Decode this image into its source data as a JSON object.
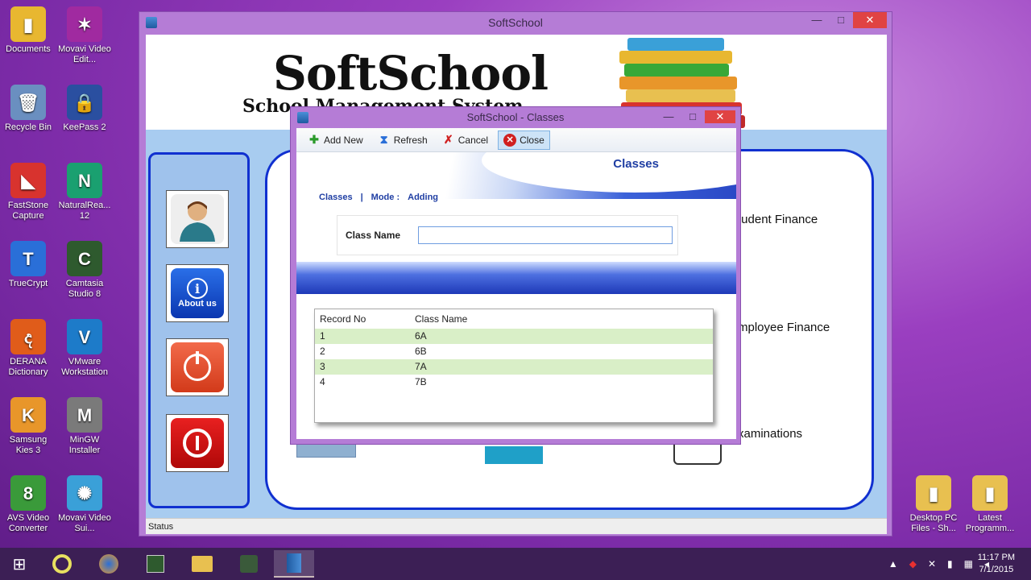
{
  "desktop": {
    "icons_left": [
      {
        "label": "Documents",
        "glyph": "▮",
        "color": "#e8b730"
      },
      {
        "label": "Recycle Bin",
        "glyph": "🗑",
        "color": "#6a8fc0"
      },
      {
        "label": "FastStone Capture",
        "glyph": "◣",
        "color": "#d8332e"
      },
      {
        "label": "TrueCrypt",
        "glyph": "T",
        "color": "#2a6fd8"
      },
      {
        "label": "DERANA Dictionary",
        "glyph": "ද",
        "color": "#e05c1a"
      },
      {
        "label": "Samsung Kies 3",
        "glyph": "K",
        "color": "#e8962a"
      },
      {
        "label": "AVS Video Converter",
        "glyph": "8",
        "color": "#3a9a3a"
      }
    ],
    "icons_mid": [
      {
        "label": "Movavi Video Edit...",
        "glyph": "✶",
        "color": "#a02aa0"
      },
      {
        "label": "KeePass 2",
        "glyph": "🔒",
        "color": "#2a4fa0"
      },
      {
        "label": "NaturalRea... 12",
        "glyph": "N",
        "color": "#1aa070"
      },
      {
        "label": "Camtasia Studio 8",
        "glyph": "C",
        "color": "#2e5a2e"
      },
      {
        "label": "VMware Workstation",
        "glyph": "V",
        "color": "#1d7bc9"
      },
      {
        "label": "MinGW Installer",
        "glyph": "M",
        "color": "#7a7a7a"
      },
      {
        "label": "Movavi Video Sui...",
        "glyph": "✺",
        "color": "#3aa0d8"
      }
    ],
    "icons_right": [
      {
        "label": "Desktop PC Files - Sh...",
        "glyph": "▮",
        "color": "#e8c050"
      },
      {
        "label": "Latest Programm...",
        "glyph": "▮",
        "color": "#e8c050"
      }
    ]
  },
  "main_window": {
    "title": "SoftSchool",
    "brand": "SoftSchool",
    "brand_sub": "School Management System",
    "side_buttons": [
      {
        "label": "",
        "icon": "user-icon"
      },
      {
        "label": "About us",
        "icon": "info-icon"
      },
      {
        "label": "",
        "icon": "logoff-icon"
      },
      {
        "label": "",
        "icon": "power-icon"
      }
    ],
    "menu_labels": [
      "tudent Finance",
      "mployee Finance",
      "xaminations"
    ],
    "status": "Status"
  },
  "dialog": {
    "title": "SoftSchool - Classes",
    "toolbar": [
      {
        "label": "Add New",
        "icon": "plus-icon",
        "color": "#2a9a2a"
      },
      {
        "label": "Refresh",
        "icon": "hourglass-icon",
        "color": "#2a6fd8"
      },
      {
        "label": "Cancel",
        "icon": "cancel-x-icon",
        "color": "#d02020"
      },
      {
        "label": "Close",
        "icon": "close-circle-icon",
        "color": "#d02020"
      }
    ],
    "header_title": "Classes",
    "crumbs": {
      "section": "Classes",
      "separator": "|",
      "mode_label": "Mode :",
      "mode_value": "Adding"
    },
    "form": {
      "label": "Class Name",
      "value": "",
      "placeholder": ""
    },
    "grid": {
      "columns": [
        "Record No",
        "Class Name"
      ],
      "rows": [
        [
          "1",
          "6A"
        ],
        [
          "2",
          "6B"
        ],
        [
          "3",
          "7A"
        ],
        [
          "4",
          "7B"
        ]
      ]
    }
  },
  "taskbar": {
    "time": "11:17 PM",
    "date": "7/1/2015"
  }
}
